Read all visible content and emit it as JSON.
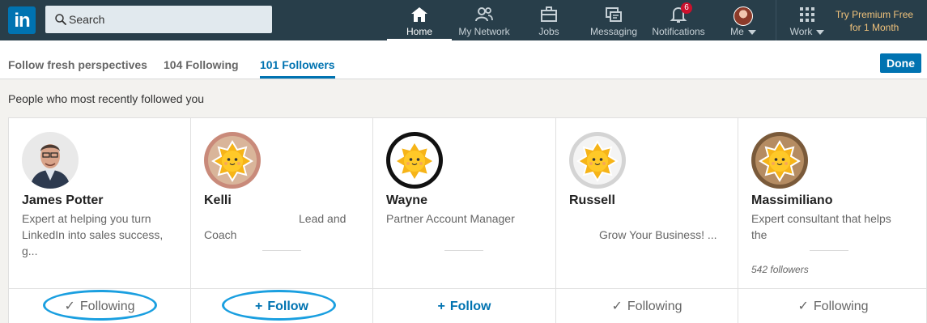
{
  "nav": {
    "logo": "in",
    "search_placeholder": "Search",
    "items": [
      {
        "label": "Home",
        "icon": "home-icon"
      },
      {
        "label": "My Network",
        "icon": "network-icon"
      },
      {
        "label": "Jobs",
        "icon": "briefcase-icon"
      },
      {
        "label": "Messaging",
        "icon": "messaging-icon"
      },
      {
        "label": "Notifications",
        "icon": "bell-icon",
        "badge": "6"
      },
      {
        "label": "Me",
        "icon": "avatar"
      },
      {
        "label": "Work",
        "icon": "grid-icon"
      }
    ],
    "premium_line1": "Try Premium Free",
    "premium_line2": "for 1 Month",
    "colors": {
      "bar": "#283e4a",
      "brand": "#0073b1",
      "premium": "#f0c27b"
    }
  },
  "tabs": [
    {
      "label": "Follow fresh perspectives"
    },
    {
      "label": "104 Following"
    },
    {
      "label": "101 Followers",
      "active": true
    }
  ],
  "done_label": "Done",
  "section_title": "People who most recently followed you",
  "cards": [
    {
      "name": "James Potter",
      "headline_l1": "Expert at helping you turn",
      "headline_l2": "LinkedIn into sales success, g...",
      "followers": "",
      "action": "Following",
      "action_icon": "check-icon"
    },
    {
      "name": "Kelli",
      "headline_l1": "Lead and",
      "headline_l2": "Coach",
      "followers": "",
      "action": "Follow",
      "action_icon": "plus-icon"
    },
    {
      "name": "Wayne",
      "headline_l1": "Partner Account Manager",
      "headline_l2": "",
      "followers": "",
      "action": "Follow",
      "action_icon": "plus-icon"
    },
    {
      "name": "Russell",
      "headline_l1": "",
      "headline_l2": "Grow Your Business! ...",
      "followers": "",
      "action": "Following",
      "action_icon": "check-icon"
    },
    {
      "name": "Massimiliano",
      "headline_l1": "Expert consultant that helps",
      "headline_l2": "the",
      "followers": "542 followers",
      "action": "Following",
      "action_icon": "check-icon"
    }
  ]
}
